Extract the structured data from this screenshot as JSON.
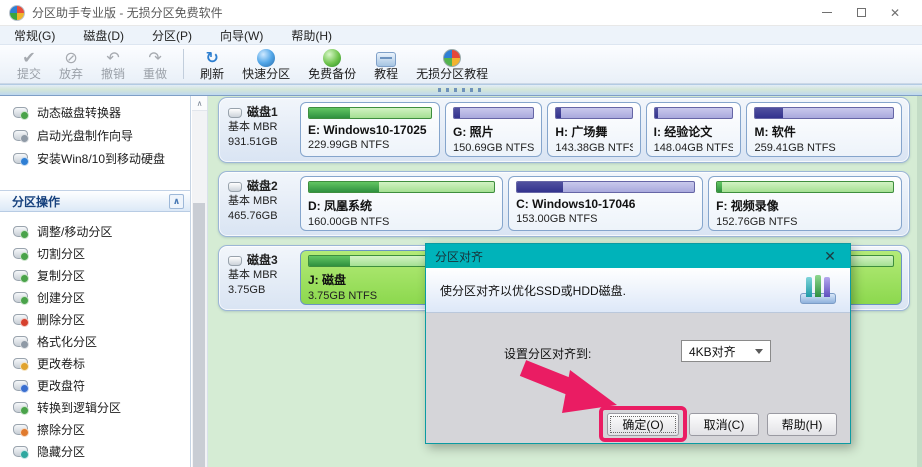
{
  "window": {
    "title": "分区助手专业版 - 无损分区免费软件",
    "close_glyph": "✕"
  },
  "menu": {
    "items": [
      "常规(G)",
      "磁盘(D)",
      "分区(P)",
      "向导(W)",
      "帮助(H)"
    ]
  },
  "toolbar": {
    "commit": "提交",
    "discard": "放弃",
    "undo": "撤销",
    "redo": "重做",
    "refresh": "刷新",
    "quick_partition": "快速分区",
    "free_backup": "免费备份",
    "tutorial": "教程",
    "lossless_tutorial": "无损分区教程",
    "refresh_glyph": "↻",
    "commit_glyph": "✔",
    "discard_glyph": "⊘",
    "undo_glyph": "↶",
    "redo_glyph": "↷"
  },
  "sidebar": {
    "wizards": [
      "动态磁盘转换器",
      "启动光盘制作向导",
      "安装Win8/10到移动硬盘"
    ],
    "section_title": "分区操作",
    "collapse_glyph": "∧",
    "scroll_up_glyph": "∧",
    "operations": [
      "调整/移动分区",
      "切割分区",
      "复制分区",
      "创建分区",
      "删除分区",
      "格式化分区",
      "更改卷标",
      "更改盘符",
      "转换到逻辑分区",
      "擦除分区",
      "隐藏分区"
    ]
  },
  "disks": [
    {
      "name": "磁盘1",
      "type": "基本 MBR",
      "size": "931.51GB",
      "partitions": [
        {
          "label": "E: Windows10-17025",
          "info": "229.99GB NTFS",
          "kind": "green",
          "used_percent": 34,
          "width_percent": 24.7
        },
        {
          "label": "G: 照片",
          "info": "150.69GB NTFS",
          "kind": "purple",
          "used_percent": 8,
          "width_percent": 16.2
        },
        {
          "label": "H: 广场舞",
          "info": "143.38GB NTFS",
          "kind": "purple",
          "used_percent": 6,
          "width_percent": 15.4
        },
        {
          "label": "I: 经验论文",
          "info": "148.04GB NTFS",
          "kind": "purple",
          "used_percent": 4,
          "width_percent": 15.9
        },
        {
          "label": "M: 软件",
          "info": "259.41GB NTFS",
          "kind": "purple",
          "used_percent": 20,
          "width_percent": 27.8
        }
      ]
    },
    {
      "name": "磁盘2",
      "type": "基本 MBR",
      "size": "465.76GB",
      "partitions": [
        {
          "label": "D: 凤凰系统",
          "info": "160.00GB NTFS",
          "kind": "green",
          "used_percent": 38,
          "width_percent": 34.4
        },
        {
          "label": "C: Windows10-17046",
          "info": "153.00GB NTFS",
          "kind": "purple",
          "used_percent": 26,
          "width_percent": 32.9
        },
        {
          "label": "F: 视频录像",
          "info": "152.76GB NTFS",
          "kind": "green",
          "used_percent": 3,
          "width_percent": 32.7
        }
      ]
    },
    {
      "name": "磁盘3",
      "type": "基本 MBR",
      "size": "3.75GB",
      "partitions": [
        {
          "label": "J: 磁盘",
          "info": "3.75GB NTFS",
          "kind": "green",
          "selected": true,
          "used_percent": 7,
          "width_percent": 100
        }
      ]
    }
  ],
  "dialog": {
    "title": "分区对齐",
    "close_glyph": "✕",
    "description": "使分区对齐以优化SSD或HDD磁盘.",
    "field_label": "设置分区对齐到:",
    "dropdown_value": "4KB对齐",
    "ok": "确定(O)",
    "cancel": "取消(C)",
    "help": "帮助(H)"
  },
  "colors": {
    "dialog_titlebar_teal": "#00b3ba",
    "highlight_pink": "#ea1c63",
    "main_background_green": "#d5ecd4",
    "selected_partition_green": "#9ade5e",
    "bar_used_green": "#3fa53f",
    "bar_used_purple": "#3b3b9e",
    "disk_box_border_blue": "#9cb6d6"
  }
}
